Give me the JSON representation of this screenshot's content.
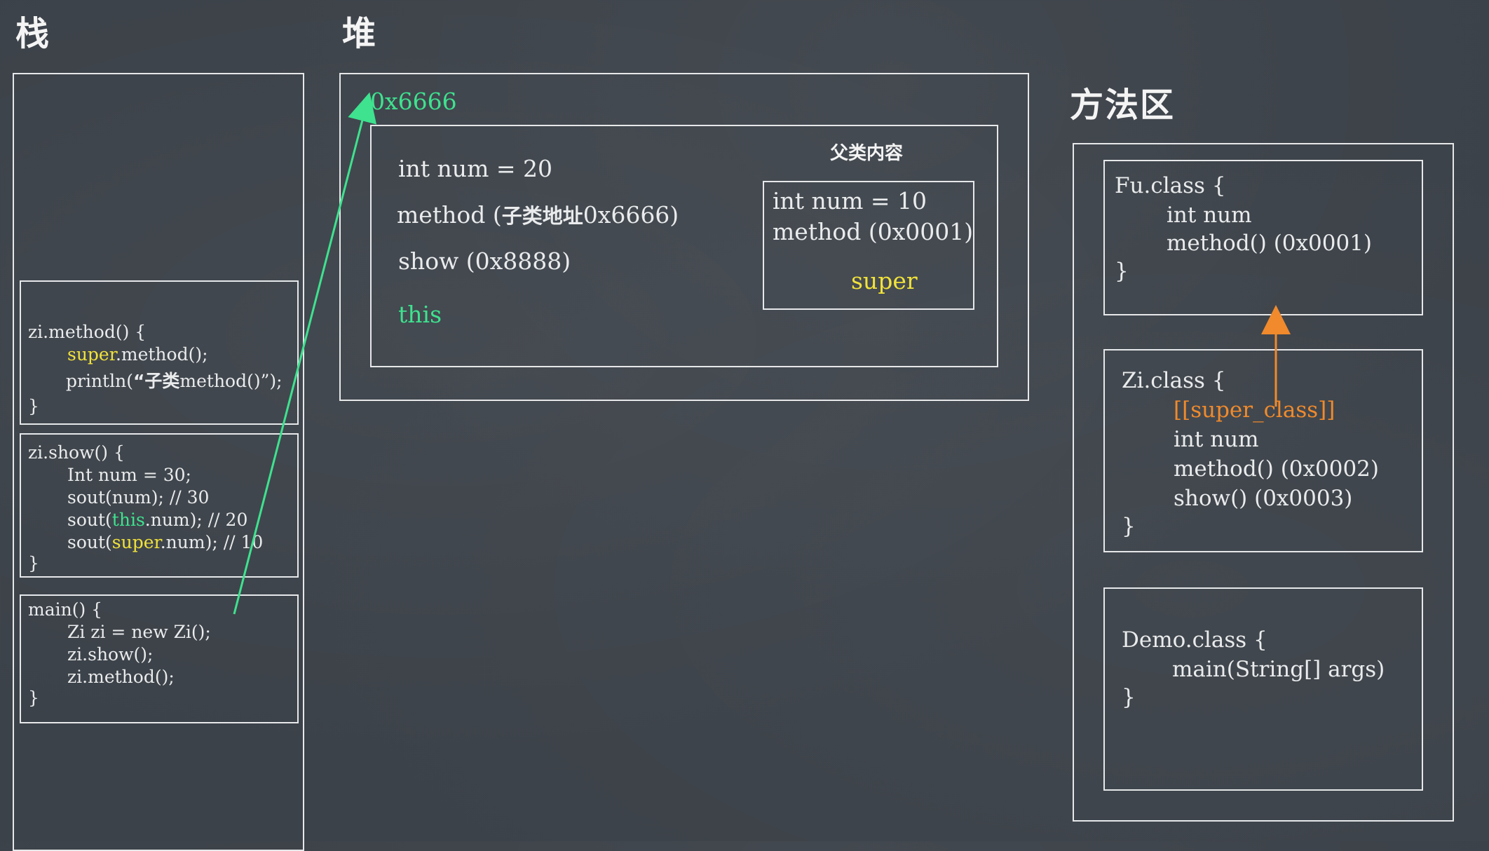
{
  "headings": {
    "stack": "栈",
    "heap": "堆",
    "method_area": "方法区"
  },
  "stack": {
    "frame_method": {
      "l1": "zi.method() {",
      "l2_kw": "super",
      "l2_rest": ".method();",
      "l3_a": "println(",
      "l3_b": "“子类",
      "l3_c": "method()”);",
      "l4": "}"
    },
    "frame_show": {
      "l1": "zi.show() {",
      "l2": "Int num = 30;",
      "l3": "sout(num); // 30",
      "l4_a": "sout(",
      "l4_kw": "this",
      "l4_b": ".num); // 20",
      "l5_a": "sout(",
      "l5_kw": "super",
      "l5_b": ".num); // 10",
      "l6": "}"
    },
    "frame_main": {
      "l1": "main() {",
      "l2": "Zi zi = new Zi();",
      "l3": "zi.show();",
      "l4": "zi.method();",
      "l5": "}"
    }
  },
  "heap": {
    "address": "0x6666",
    "l1": "int num = 20",
    "l2_a": "method (",
    "l2_b": "子类地址",
    "l2_c": "0x6666)",
    "l3": "show (0x8888)",
    "this_label": "this",
    "parent_title": "父类内容",
    "parent_l1": "int num = 10",
    "parent_l2": "method (0x0001)",
    "super_label": "super"
  },
  "method_area": {
    "fu": {
      "l1": "Fu.class {",
      "l2": "int num",
      "l3": "method() (0x0001)",
      "l4": "}"
    },
    "zi": {
      "l1": "Zi.class {",
      "l2": "[[super_class]]",
      "l3": "int num",
      "l4": "method() (0x0002)",
      "l5": "show() (0x0003)",
      "l6": "}"
    },
    "demo": {
      "l1": "Demo.class {",
      "l2": "main(String[] args)",
      "l3": "}"
    }
  },
  "colors": {
    "background": "#3c4249",
    "chalk": "#e6e8ea",
    "green": "#3ee28f",
    "yellow": "#f1e23a",
    "orange": "#f08a2c"
  }
}
